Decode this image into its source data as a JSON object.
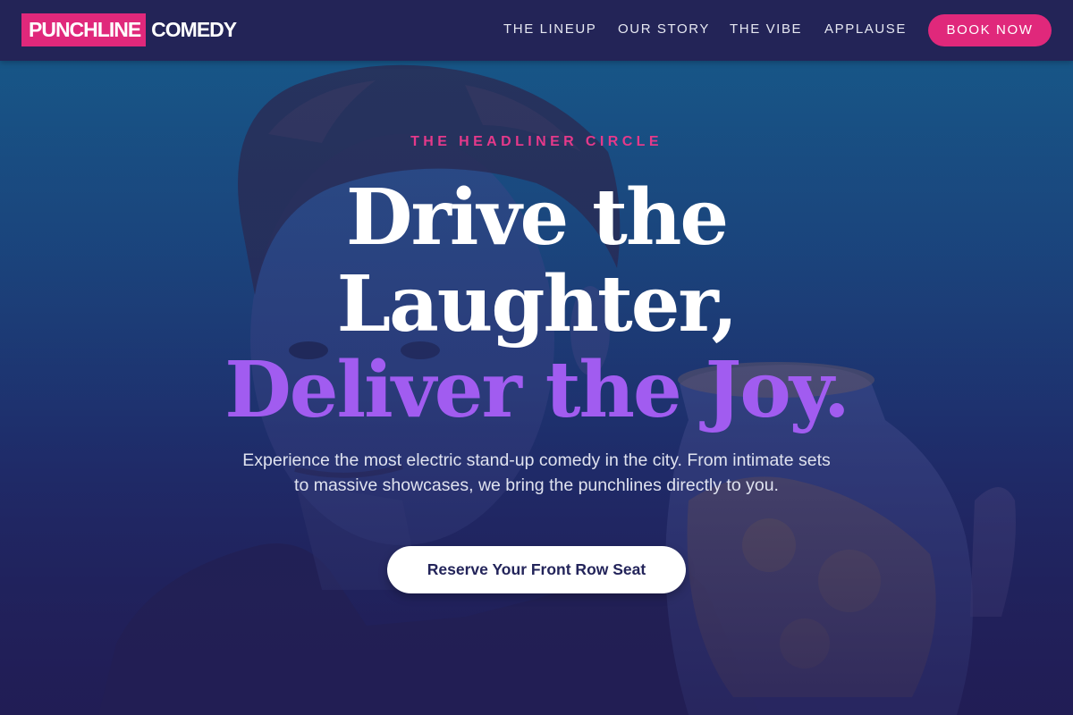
{
  "brand": {
    "logo_mark": "PUNCHLINE",
    "logo_word": "COMEDY",
    "accent_color": "#e0287b",
    "nav_bg": "#232457"
  },
  "nav": {
    "links": [
      "THE LINEUP",
      "OUR STORY",
      "THE VIBE",
      "APPLAUSE"
    ],
    "cta_label": "BOOK NOW"
  },
  "hero": {
    "eyebrow": "THE HEADLINER CIRCLE",
    "headline_line1": "Drive the",
    "headline_line2": "Laughter,",
    "headline_line3": "Deliver the Joy.",
    "headline_accent_color": "#a15cf0",
    "subtext": "Experience the most electric stand-up comedy in the city. From intimate sets to massive showcases, we bring the punchlines directly to you.",
    "cta_label": "Reserve Your Front Row Seat",
    "background": "photo of a man holding a jar"
  }
}
